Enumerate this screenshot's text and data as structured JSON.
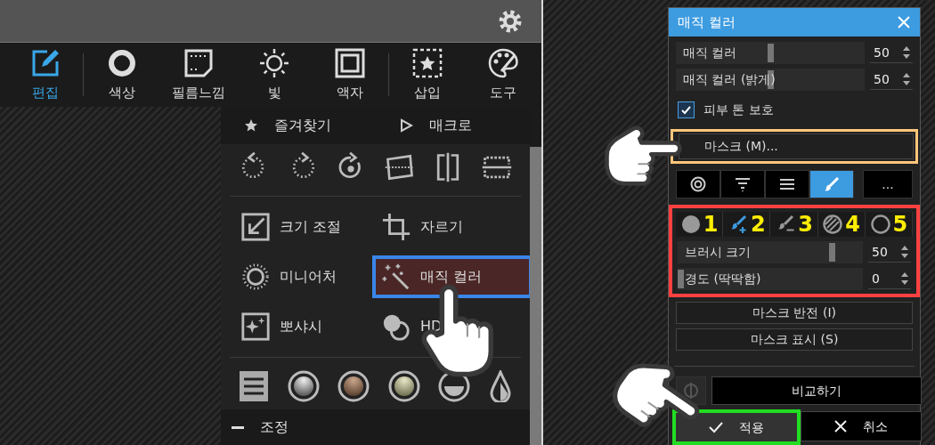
{
  "toolbar": [
    {
      "label": "편집",
      "selected": true
    },
    {
      "label": "색상",
      "selected": false
    },
    {
      "label": "필름느낌",
      "selected": false
    },
    {
      "label": "빛",
      "selected": false
    },
    {
      "label": "액자",
      "selected": false
    },
    {
      "label": "삽입",
      "selected": false
    },
    {
      "label": "도구",
      "selected": false
    }
  ],
  "menu_tabs": [
    {
      "label": "즐겨찾기"
    },
    {
      "label": "매크로"
    }
  ],
  "tools": [
    {
      "label": "크기 조절",
      "highlighted": false
    },
    {
      "label": "자르기",
      "highlighted": false
    },
    {
      "label": "미니어처",
      "highlighted": false
    },
    {
      "label": "매직 컬러",
      "highlighted": true
    },
    {
      "label": "뽀샤시",
      "highlighted": false
    },
    {
      "label": "HD",
      "highlighted": false
    }
  ],
  "section": {
    "label": "조정",
    "expanded": true
  },
  "dialog": {
    "title": "매직 컬러",
    "sliders": [
      {
        "label": "매직 컬러",
        "level": 0.5,
        "value": "50"
      },
      {
        "label": "매직 컬러 (밝게)",
        "level": 0.5,
        "value": "50"
      }
    ],
    "skin_protect": {
      "label": "피부 톤 보호",
      "checked": true
    },
    "mask_button": {
      "label": "마스크 (M)...",
      "outlined": true
    },
    "mask_tabs": [
      {
        "selected": false
      },
      {
        "selected": false
      },
      {
        "selected": false
      },
      {
        "selected": true
      }
    ],
    "more_button": "...",
    "brush_outlined": true,
    "brush_tools": [
      {
        "number": "1",
        "selected": false
      },
      {
        "number": "2",
        "selected": true
      },
      {
        "number": "3",
        "selected": false
      },
      {
        "number": "4",
        "selected": false
      },
      {
        "number": "5",
        "selected": false
      }
    ],
    "brush_sliders": [
      {
        "label": "브러시 크기",
        "level": 0.83,
        "value": "50"
      },
      {
        "label": "경도 (딱딱함)",
        "level": 0,
        "value": "0"
      }
    ],
    "buttons": [
      {
        "label": "마스크 반전 (I)"
      },
      {
        "label": "마스크 표시 (S)"
      }
    ],
    "compare": "비교하기",
    "apply": {
      "label": "적용",
      "outlined": true
    },
    "cancel": {
      "label": "취소"
    }
  }
}
